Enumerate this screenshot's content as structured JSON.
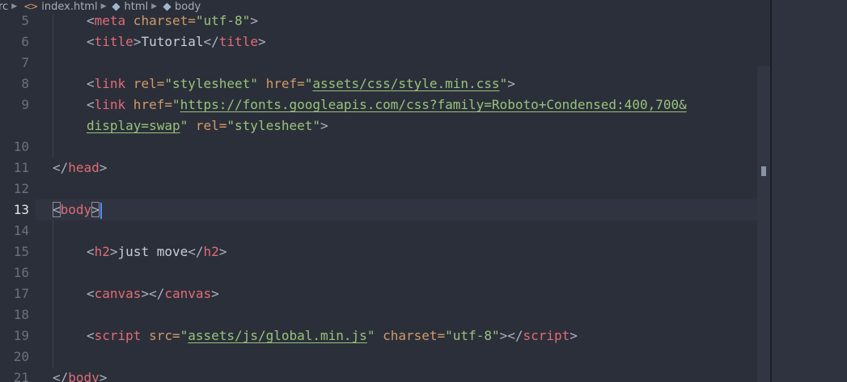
{
  "breadcrumb": {
    "segments": [
      {
        "label": "rc",
        "icon": "none"
      },
      {
        "label": "index.html",
        "icon": "html-tag-icon"
      },
      {
        "label": "html",
        "icon": "cube-icon"
      },
      {
        "label": "body",
        "icon": "cube-icon"
      }
    ]
  },
  "editor": {
    "active_line": "13",
    "line_numbers": [
      "5",
      "6",
      "7",
      "8",
      "9",
      "",
      "10",
      "11",
      "12",
      "13",
      "14",
      "15",
      "16",
      "17",
      "18",
      "19",
      "20",
      "21"
    ],
    "lines": {
      "l5": {
        "open": "<",
        "tag": "meta",
        "attr": " charset=",
        "val": "\"utf-8\"",
        "close": ">"
      },
      "l6": {
        "open": "<",
        "tag": "title",
        "mid": ">",
        "text": "Tutorial",
        "open2": "</",
        "tag2": "title",
        "close": ">"
      },
      "l8": {
        "open": "<",
        "tag": "link",
        "attr1": " rel=",
        "val1": "\"stylesheet\"",
        "attr2": " href=",
        "q1": "\"",
        "url": "assets/css/style.min.css",
        "q2": "\"",
        "close": ">"
      },
      "l9a": {
        "open": "<",
        "tag": "link",
        "attr1": " href=",
        "q1": "\"",
        "url": "https://fonts.googleapis.com/css?family=Roboto+Condensed:400,700&"
      },
      "l9b": {
        "url": "display=swap",
        "q2": "\"",
        "attr2": " rel=",
        "val2": "\"stylesheet\"",
        "close": ">"
      },
      "l11": {
        "open": "</",
        "tag": "head",
        "close": ">"
      },
      "l13": {
        "open": "<",
        "tag": "body",
        "close": ">"
      },
      "l15": {
        "open": "<",
        "tag": "h2",
        "mid": ">",
        "text": "just move",
        "open2": "</",
        "tag2": "h2",
        "close": ">"
      },
      "l17": {
        "open": "<",
        "tag": "canvas",
        "mid": "></",
        "tag2": "canvas",
        "close": ">"
      },
      "l19": {
        "open": "<",
        "tag": "script",
        "attr1": " src=",
        "q1": "\"",
        "url": "assets/js/global.min.js",
        "q2": "\"",
        "attr2": " charset=",
        "val2": "\"utf-8\"",
        "mid": "></",
        "tag2": "script",
        "close": ">"
      },
      "l21": {
        "open": "</",
        "tag": "body",
        "close": ">"
      }
    }
  },
  "colors": {
    "background": "#2b2f3a",
    "tag": "#e06c75",
    "attribute": "#d19a66",
    "string": "#98c379",
    "cursor": "#528bff"
  }
}
